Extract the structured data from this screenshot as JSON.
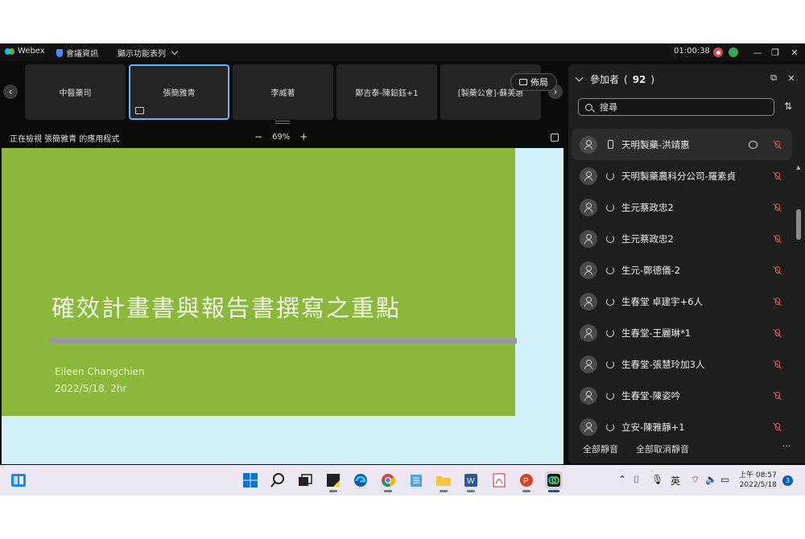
{
  "titlebar": {
    "app_name": "Webex",
    "meeting_info": "會議資訊",
    "view_menu": "顯示功能表列",
    "timer": "01:00:38",
    "colors": {
      "record": "#e0464e",
      "audio": "#3aa655"
    }
  },
  "filmstrip": {
    "tiles": [
      {
        "label": "中醫藥司"
      },
      {
        "label": "張簡雅青"
      },
      {
        "label": "李威著"
      },
      {
        "label": "鄭吉泰-陳鉛鈺+1"
      },
      {
        "label": "[製藥公會]-蘇美惠"
      }
    ],
    "layout_label": "佈局"
  },
  "share": {
    "message": "正在檢視 張簡雅青 的應用程式",
    "zoom_minus": "−",
    "zoom_level": "69%",
    "zoom_plus": "+"
  },
  "slide": {
    "title": "確效計畫書與報告書撰寫之重點",
    "author": "Eileen Changchien",
    "date": "2022/5/18, 2hr",
    "colors": {
      "background": "#8bb73a",
      "stage": "#d3f1fb"
    }
  },
  "participants": {
    "header_label": "參加者",
    "count": "92",
    "search_placeholder": "搜尋",
    "list": [
      {
        "name": "天明製藥-洪靖惠",
        "device": "phone-icon",
        "muted": true
      },
      {
        "name": "天明製藥農科分公司-羅素貞",
        "device": "sync-icon",
        "muted": true
      },
      {
        "name": "生元蔡政忠2",
        "device": "sync-icon",
        "muted": true
      },
      {
        "name": "生元蔡政忠2",
        "device": "sync-icon",
        "muted": true
      },
      {
        "name": "生元-鄭德儀-2",
        "device": "sync-icon",
        "muted": true
      },
      {
        "name": "生春堂 卓建宇+6人",
        "device": "sync-icon",
        "muted": true
      },
      {
        "name": "生春堂-王麗琳*1",
        "device": "sync-icon",
        "muted": true
      },
      {
        "name": "生春堂-張慧玲加3人",
        "device": "sync-icon",
        "muted": true
      },
      {
        "name": "生春堂-陳姿吟",
        "device": "sync-icon",
        "muted": true
      },
      {
        "name": "立安-陳雅靜+1",
        "device": "sync-icon",
        "muted": true
      }
    ],
    "mute_all": "全部靜音",
    "unmute_all": "全部取消靜音",
    "more": "···"
  },
  "taskbar": {
    "ime": "英",
    "time": "上午 08:57",
    "date": "2022/5/18",
    "notifications": "3"
  }
}
